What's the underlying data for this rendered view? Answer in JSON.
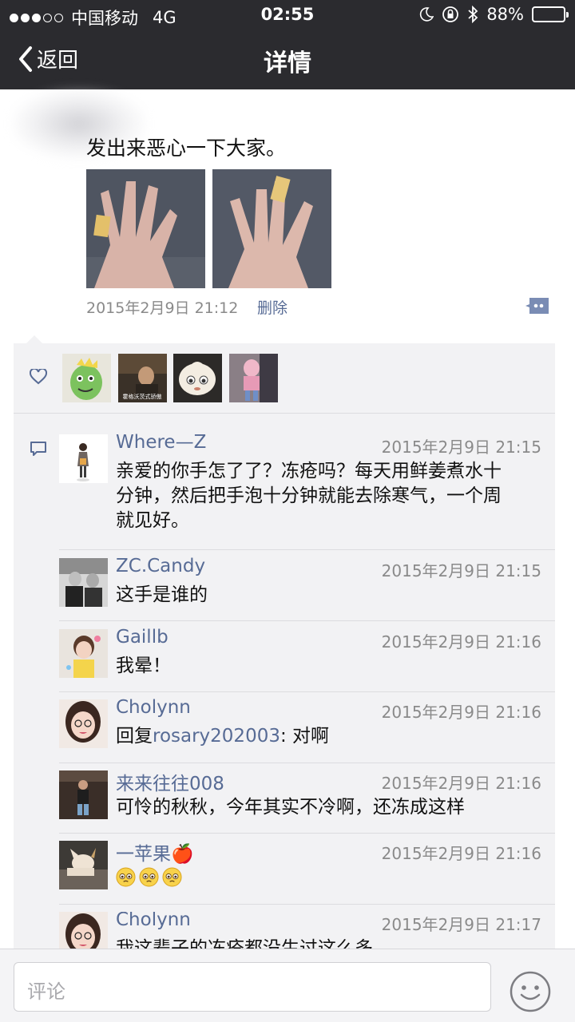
{
  "status": {
    "carrier": "中国移动",
    "network": "4G",
    "time": "02:55",
    "battery": "88%",
    "battery_level": 0.88
  },
  "nav": {
    "back_label": "返回",
    "title": "详情"
  },
  "post": {
    "text": "发出来恶心一下大家。",
    "time": "2015年2月9日 21:12",
    "delete_label": "删除"
  },
  "comments": [
    {
      "name": "Where—Z",
      "time": "2015年2月9日 21:15",
      "text": "亲爱的你手怎了了？冻疮吗？每天用鲜姜煮水十分钟，然后把手泡十分钟就能去除寒气，一个周就见好。"
    },
    {
      "name": "ZC.Candy",
      "time": "2015年2月9日 21:15",
      "text": "这手是谁的"
    },
    {
      "name": "Gaillb",
      "time": "2015年2月9日 21:16",
      "text": "我晕！"
    },
    {
      "name": "Cholynn",
      "time": "2015年2月9日 21:16",
      "reply_prefix": "回复",
      "reply_to": "rosary202003",
      "text": ": 对啊"
    },
    {
      "name": "来来往往008",
      "time": "2015年2月9日 21:16",
      "text": "可怜的秋秋，今年其实不冷啊，还冻成这样"
    },
    {
      "name": "一苹果🍎",
      "time": "2015年2月9日 21:16",
      "text": "🥺🥺🥺"
    },
    {
      "name": "Cholynn",
      "time": "2015年2月9日 21:17",
      "text": "我这辈子的冻疮都没生过这么多"
    }
  ],
  "like_avatar_caption": "霍格沃茨式骄傲",
  "input": {
    "placeholder": "评论"
  },
  "colors": {
    "nav_bg": "#2b2b2f",
    "link": "#576b95",
    "panel_bg": "#f2f2f4",
    "time_gray": "#8a8a8a"
  },
  "icons": [
    "back-chevron-icon",
    "heart-icon",
    "comment-icon",
    "more-comment-icon",
    "emoji-icon"
  ]
}
